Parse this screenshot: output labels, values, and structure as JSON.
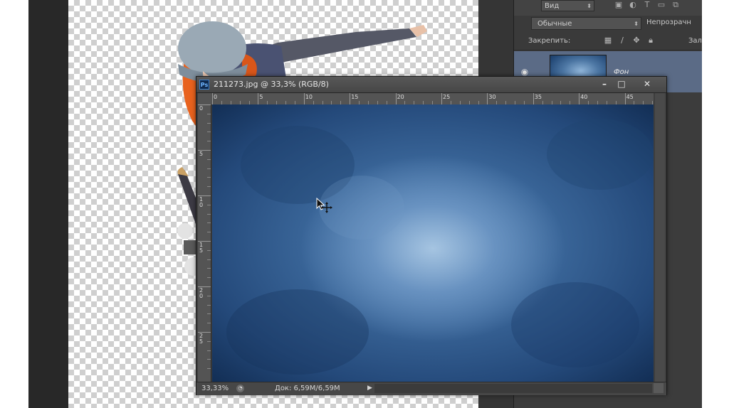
{
  "document": {
    "title": "211273.jpg @ 33,3% (RGB/8)",
    "ps_badge": "Ps",
    "window_buttons": {
      "minimize": "–",
      "maximize": "□",
      "close": "✕"
    },
    "ruler_top_labels": [
      "0",
      "5",
      "10",
      "15",
      "20",
      "25",
      "30",
      "35",
      "40",
      "45"
    ],
    "ruler_left_labels": [
      [
        "0"
      ],
      [
        "5"
      ],
      [
        "1",
        "0"
      ],
      [
        "1",
        "5"
      ],
      [
        "2",
        "0"
      ],
      [
        "2",
        "5"
      ]
    ],
    "status": {
      "zoom": "33,33%",
      "doc_size": "Док: 6,59M/6,59M",
      "arrow": "▶"
    }
  },
  "layers_panel": {
    "kind_filter": "Вид",
    "blend_mode": "Обычные",
    "opacity_label": "Непрозрачн",
    "lock_label": "Закрепить:",
    "fill_label": "Зал",
    "layer": {
      "name": "Фон"
    }
  },
  "colors": {
    "workspace": "#282828",
    "panel": "#3c3c3c",
    "selected_layer": "#5b6b86",
    "texture_blue": "#24497a"
  },
  "icons": {
    "kind_filter": [
      "image-filter-icon",
      "adjust-filter-icon",
      "type-filter-icon",
      "shape-filter-icon",
      "smart-filter-icon"
    ],
    "lock": [
      "lock-transparent-icon",
      "lock-brush-icon",
      "lock-position-icon",
      "lock-all-icon"
    ],
    "layer_visibility": "eye-icon",
    "cursor": "move-cursor-icon"
  }
}
